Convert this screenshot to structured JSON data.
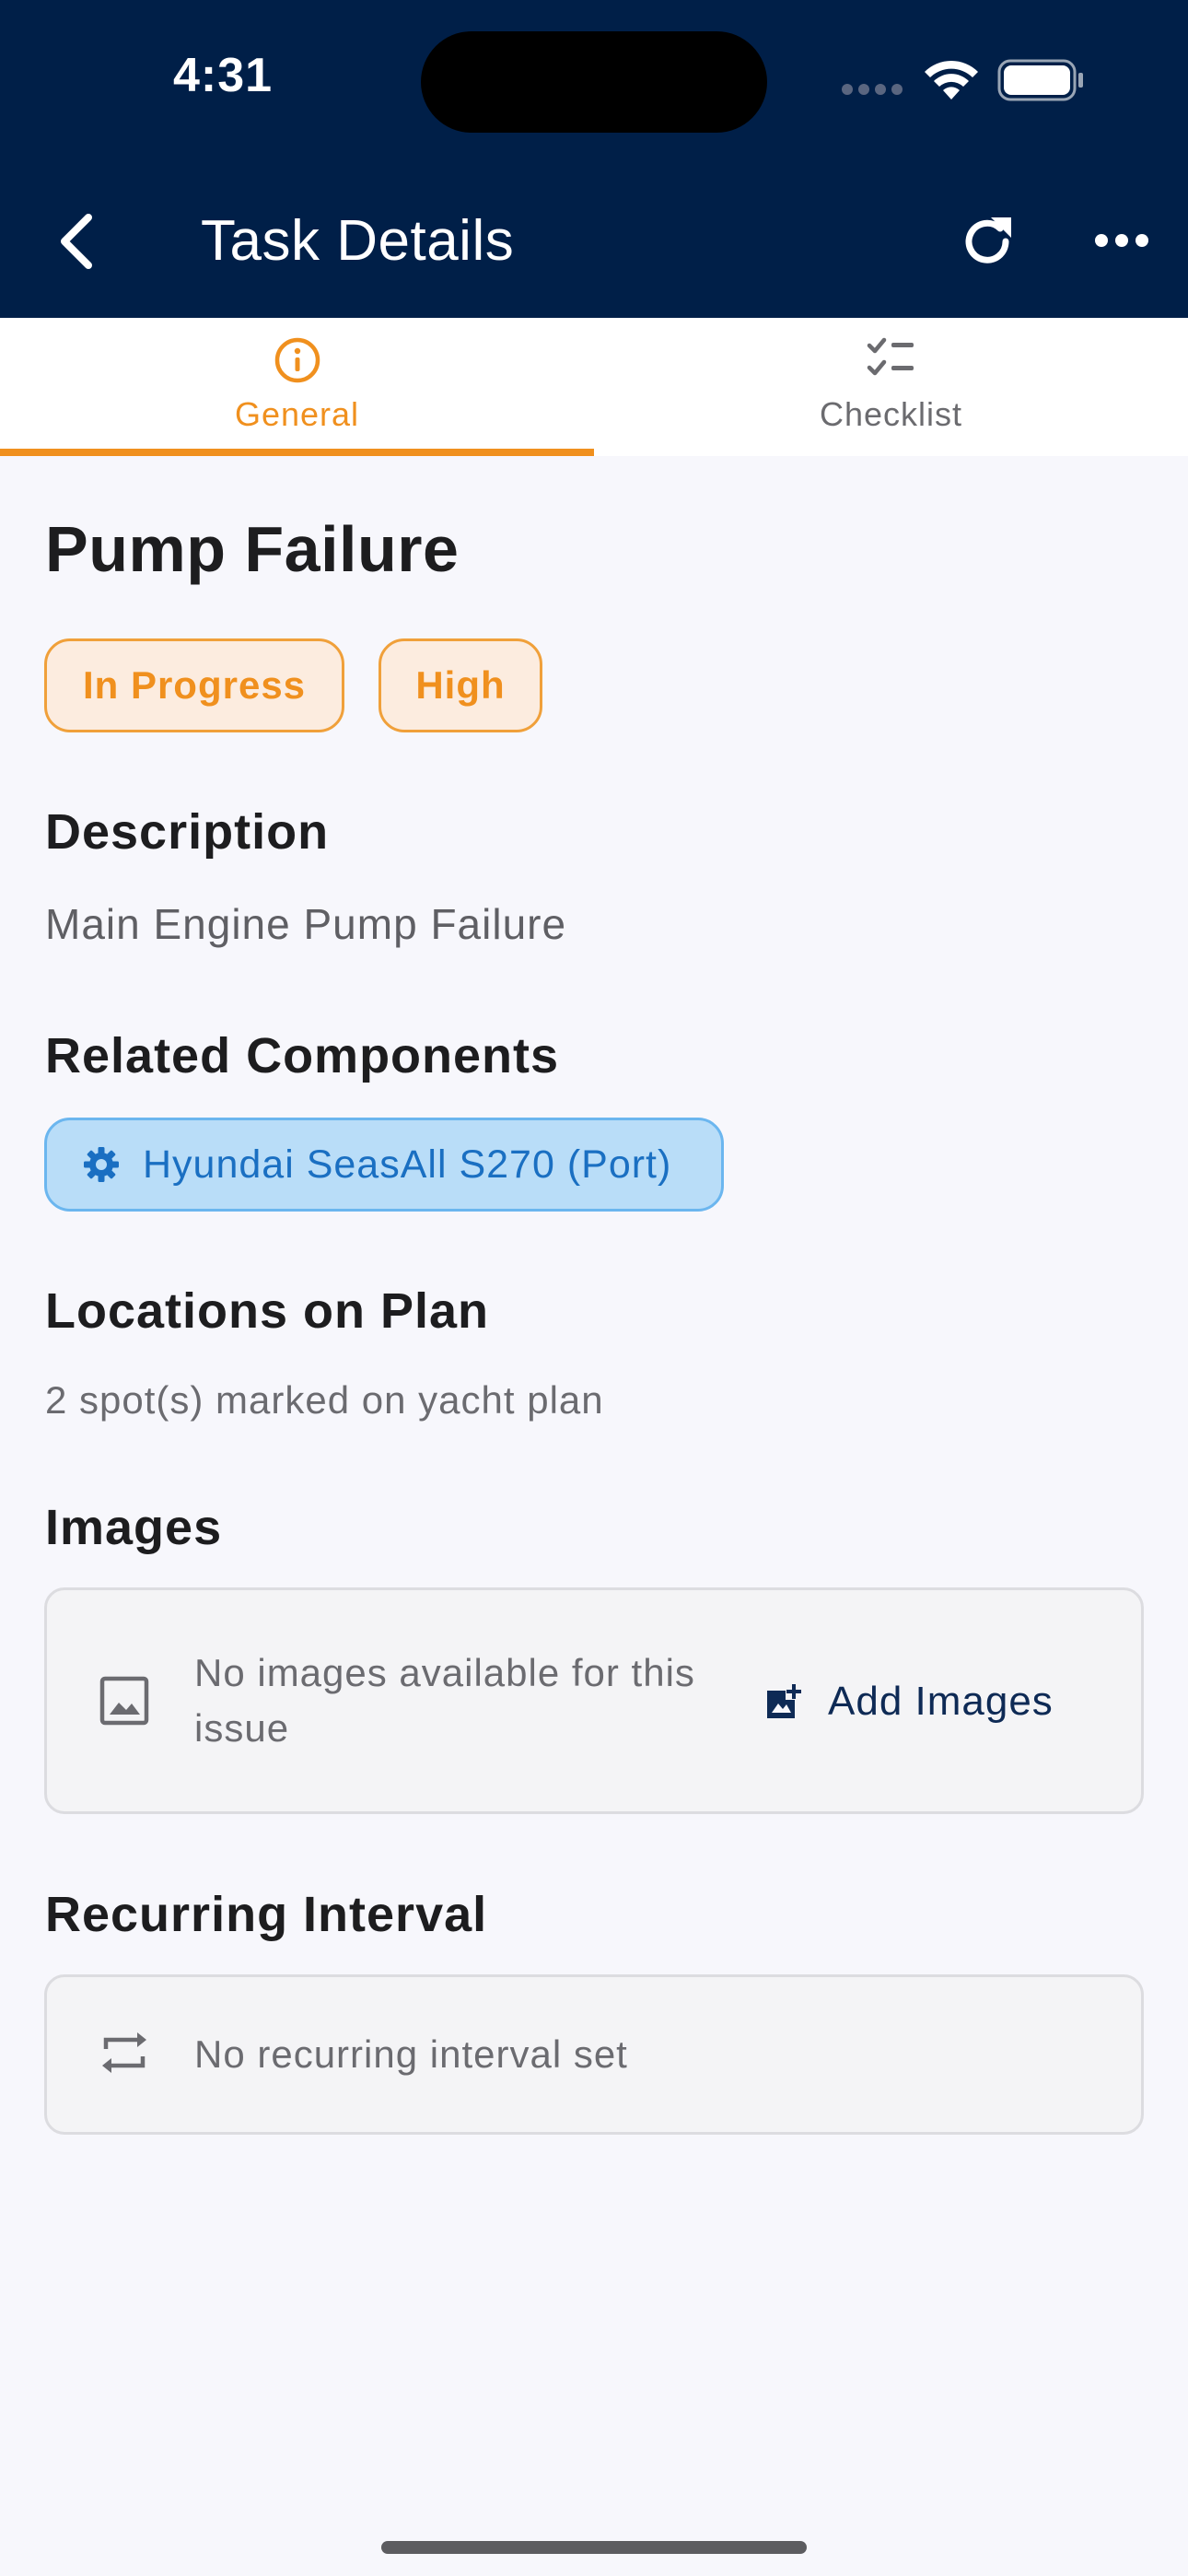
{
  "status_bar": {
    "time": "4:31"
  },
  "app_bar": {
    "title": "Task Details",
    "back_icon": "chevron-left-icon",
    "refresh_icon": "refresh-icon",
    "more_icon": "more-horizontal-icon",
    "background_color": "#001f48"
  },
  "tabs": [
    {
      "label": "General",
      "icon": "info-circle-icon",
      "selected": true
    },
    {
      "label": "Checklist",
      "icon": "checklist-icon",
      "selected": false
    }
  ],
  "accent_color": "#f0901e",
  "task": {
    "title": "Pump Failure",
    "status": "In Progress",
    "priority": "High"
  },
  "description": {
    "heading": "Description",
    "text": "Main Engine Pump Failure"
  },
  "related_components": {
    "heading": "Related Components",
    "items": [
      {
        "label": "Hyundai SeasAll S270 (Port)",
        "icon": "gear-icon"
      }
    ]
  },
  "locations": {
    "heading": "Locations on Plan",
    "text": "2 spot(s) marked on yacht plan"
  },
  "images": {
    "heading": "Images",
    "empty_text": "No images available for this issue",
    "add_label": "Add Images",
    "empty_icon": "image-icon",
    "add_icon": "add-photo-icon"
  },
  "recurring": {
    "heading": "Recurring Interval",
    "text": "No recurring interval set",
    "icon": "repeat-icon"
  }
}
